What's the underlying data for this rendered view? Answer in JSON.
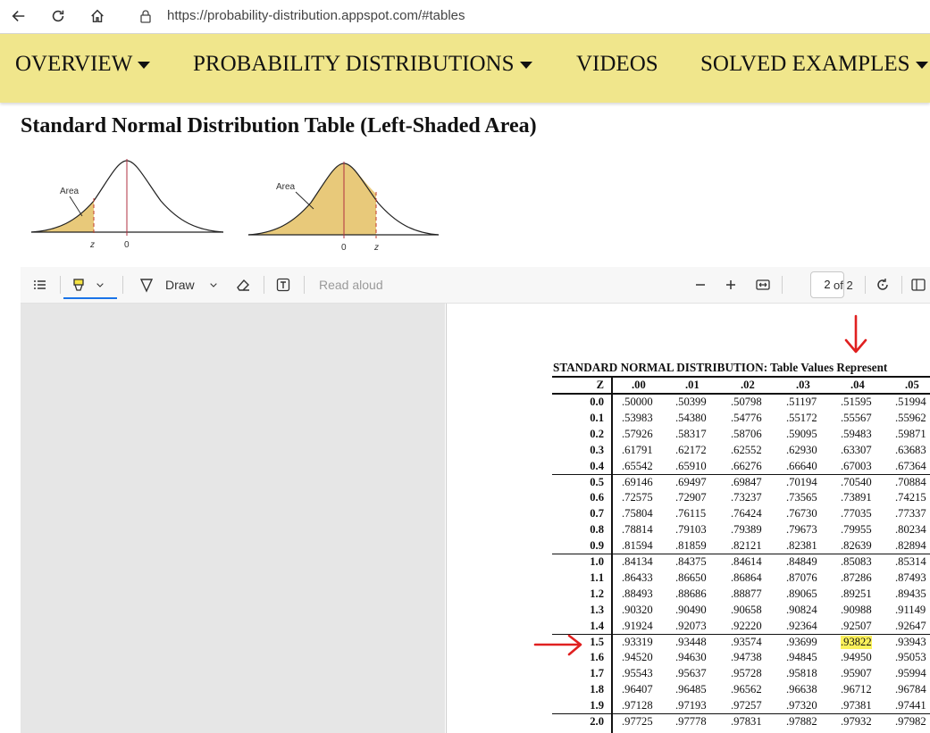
{
  "browser": {
    "url": "https://probability-distribution.appspot.com/#tables"
  },
  "site_nav": {
    "items": [
      "OVERVIEW",
      "PROBABILITY DISTRIBUTIONS",
      "VIDEOS",
      "SOLVED EXAMPLES"
    ]
  },
  "page_title": "Standard Normal Distribution Table (Left-Shaded Area)",
  "figures": {
    "left": {
      "area_label": "Area",
      "z_label": "z",
      "zero_label": "0"
    },
    "right": {
      "area_label": "Area",
      "z_label": "z",
      "zero_label": "0"
    }
  },
  "pdf_toolbar": {
    "draw_label": "Draw",
    "read_aloud_label": "Read aloud",
    "page_value": "2",
    "page_total": "of 2"
  },
  "table": {
    "title": "STANDARD NORMAL DISTRIBUTION: Table Values Represent",
    "z_header": "Z",
    "col_headers": [
      ".00",
      ".01",
      ".02",
      ".03",
      ".04",
      ".05"
    ],
    "rows": [
      {
        "z": "0.0",
        "values": [
          ".50000",
          ".50399",
          ".50798",
          ".51197",
          ".51595",
          ".51994"
        ]
      },
      {
        "z": "0.1",
        "values": [
          ".53983",
          ".54380",
          ".54776",
          ".55172",
          ".55567",
          ".55962"
        ]
      },
      {
        "z": "0.2",
        "values": [
          ".57926",
          ".58317",
          ".58706",
          ".59095",
          ".59483",
          ".59871"
        ]
      },
      {
        "z": "0.3",
        "values": [
          ".61791",
          ".62172",
          ".62552",
          ".62930",
          ".63307",
          ".63683"
        ]
      },
      {
        "z": "0.4",
        "values": [
          ".65542",
          ".65910",
          ".66276",
          ".66640",
          ".67003",
          ".67364"
        ]
      },
      {
        "z": "0.5",
        "values": [
          ".69146",
          ".69497",
          ".69847",
          ".70194",
          ".70540",
          ".70884"
        ]
      },
      {
        "z": "0.6",
        "values": [
          ".72575",
          ".72907",
          ".73237",
          ".73565",
          ".73891",
          ".74215"
        ]
      },
      {
        "z": "0.7",
        "values": [
          ".75804",
          ".76115",
          ".76424",
          ".76730",
          ".77035",
          ".77337"
        ]
      },
      {
        "z": "0.8",
        "values": [
          ".78814",
          ".79103",
          ".79389",
          ".79673",
          ".79955",
          ".80234"
        ]
      },
      {
        "z": "0.9",
        "values": [
          ".81594",
          ".81859",
          ".82121",
          ".82381",
          ".82639",
          ".82894"
        ]
      },
      {
        "z": "1.0",
        "values": [
          ".84134",
          ".84375",
          ".84614",
          ".84849",
          ".85083",
          ".85314"
        ]
      },
      {
        "z": "1.1",
        "values": [
          ".86433",
          ".86650",
          ".86864",
          ".87076",
          ".87286",
          ".87493"
        ]
      },
      {
        "z": "1.2",
        "values": [
          ".88493",
          ".88686",
          ".88877",
          ".89065",
          ".89251",
          ".89435"
        ]
      },
      {
        "z": "1.3",
        "values": [
          ".90320",
          ".90490",
          ".90658",
          ".90824",
          ".90988",
          ".91149"
        ]
      },
      {
        "z": "1.4",
        "values": [
          ".91924",
          ".92073",
          ".92220",
          ".92364",
          ".92507",
          ".92647"
        ]
      },
      {
        "z": "1.5",
        "values": [
          ".93319",
          ".93448",
          ".93574",
          ".93699",
          ".93822",
          ".93943"
        ]
      },
      {
        "z": "1.6",
        "values": [
          ".94520",
          ".94630",
          ".94738",
          ".94845",
          ".94950",
          ".95053"
        ]
      },
      {
        "z": "1.7",
        "values": [
          ".95543",
          ".95637",
          ".95728",
          ".95818",
          ".95907",
          ".95994"
        ]
      },
      {
        "z": "1.8",
        "values": [
          ".96407",
          ".96485",
          ".96562",
          ".96638",
          ".96712",
          ".96784"
        ]
      },
      {
        "z": "1.9",
        "values": [
          ".97128",
          ".97193",
          ".97257",
          ".97320",
          ".97381",
          ".97441"
        ]
      },
      {
        "z": "2.0",
        "values": [
          ".97725",
          ".97778",
          ".97831",
          ".97882",
          ".97932",
          ".97982"
        ]
      }
    ],
    "highlight": {
      "row": 15,
      "col": 4,
      "color": "#fbf15b"
    },
    "annotation_color": "#e02020"
  },
  "colors": {
    "nav_bg": "#f0e68c",
    "curve_fill": "#e8c97a",
    "highlight": "#fbf15b",
    "annotation": "#e02020"
  }
}
